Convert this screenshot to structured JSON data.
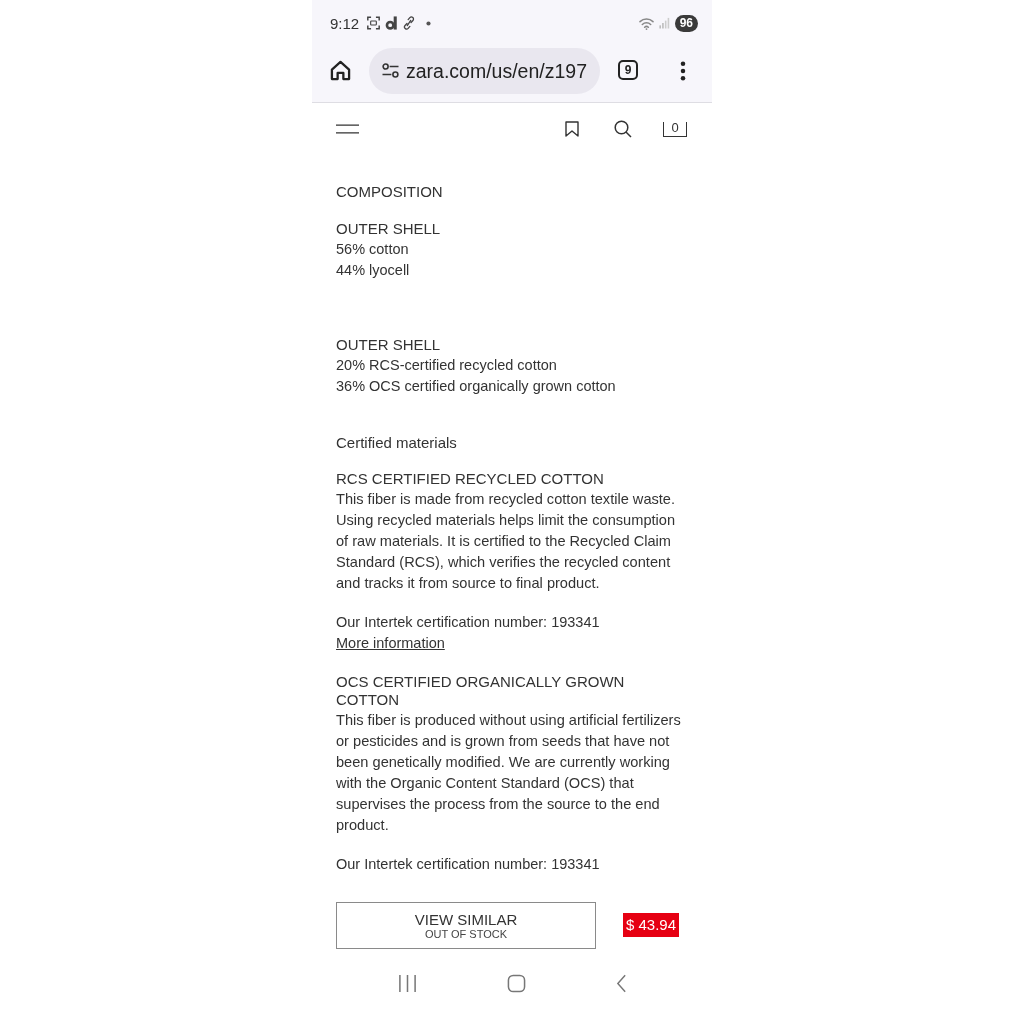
{
  "status_bar": {
    "time": "9:12",
    "battery": "96"
  },
  "browser": {
    "url": "zara.com/us/en/z197",
    "tab_count": "9"
  },
  "site_header": {
    "cart_count": "0"
  },
  "composition": {
    "title": "COMPOSITION",
    "parts": [
      {
        "heading": "OUTER SHELL",
        "lines": [
          "56% cotton",
          "44% lyocell"
        ]
      },
      {
        "heading": "OUTER SHELL",
        "lines": [
          "20% RCS-certified recycled cotton",
          "36% OCS certified organically grown cotton"
        ]
      }
    ]
  },
  "certified_materials": {
    "title": "Certified materials",
    "items": [
      {
        "heading": "RCS CERTIFIED RECYCLED COTTON",
        "description": "This fiber is made from recycled cotton textile waste. Using recycled materials helps limit the consumption of raw materials. It is certified to the Recycled Claim Standard (RCS), which verifies the recycled content and tracks it from source to final product.",
        "certification": "Our Intertek certification number: 193341",
        "link": "More information"
      },
      {
        "heading": "OCS CERTIFIED ORGANICALLY GROWN COTTON",
        "description": "This fiber is produced without using artificial fertilizers or pesticides and is grown from seeds that have not been genetically modified. We are currently working with the Organic Content Standard (OCS) that supervises the process from the source to the end product.",
        "certification": "Our Intertek certification number: 193341"
      }
    ]
  },
  "purchase_bar": {
    "button_label": "VIEW SIMILAR",
    "button_sublabel": "OUT OF STOCK",
    "price": "$ 43.94"
  }
}
